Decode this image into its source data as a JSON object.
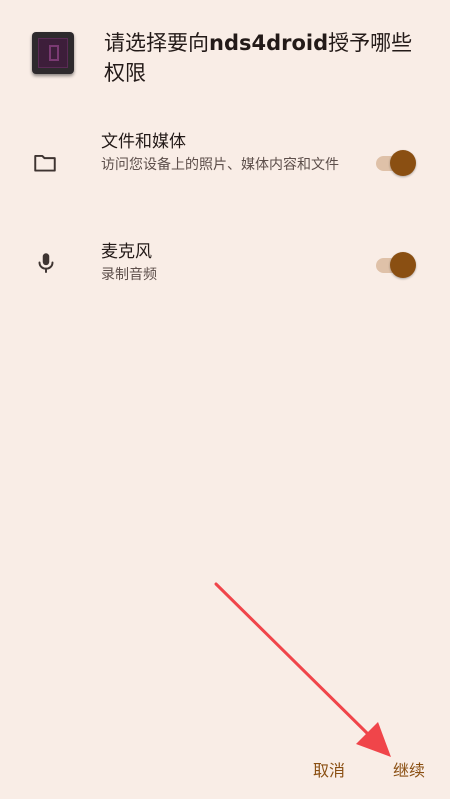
{
  "dialog": {
    "title_prefix": "请选择要向",
    "app_name": "nds4droid",
    "title_suffix": "授予哪些权限"
  },
  "permissions": [
    {
      "title": "文件和媒体",
      "description": "访问您设备上的照片、媒体内容和文件",
      "icon": "folder-icon",
      "enabled": true
    },
    {
      "title": "麦克风",
      "description": "录制音频",
      "icon": "microphone-icon",
      "enabled": true
    }
  ],
  "actions": {
    "cancel_label": "取消",
    "continue_label": "继续"
  },
  "colors": {
    "background": "#f9ede6",
    "accent": "#8a4f12",
    "toggle_track": "#dfc1a8",
    "annotation_arrow": "#f0454a"
  }
}
